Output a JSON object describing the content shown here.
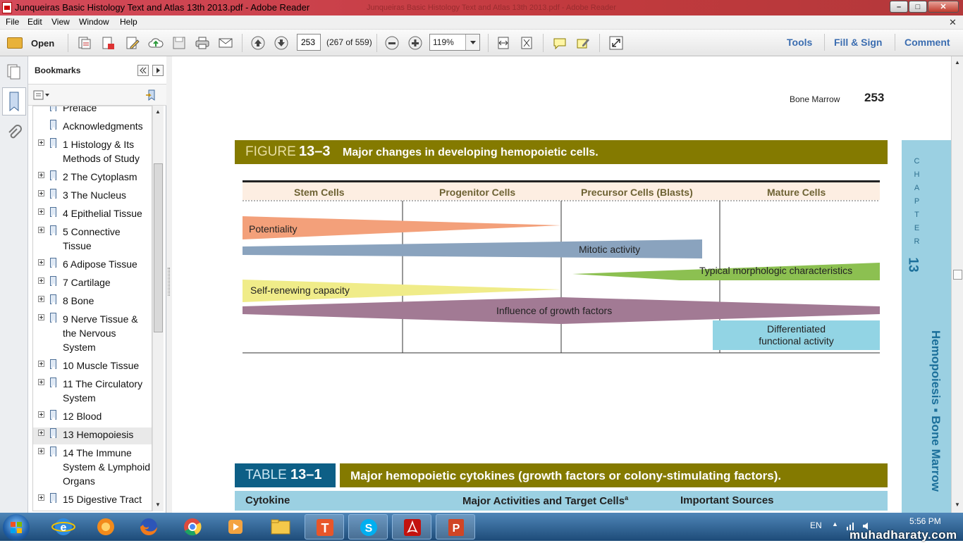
{
  "window": {
    "title": "Junqueiras Basic Histology Text and Atlas 13th 2013.pdf - Adobe Reader",
    "ghost_title": "Junqueiras Basic Histology Text and Atlas 13th 2013.pdf - Adobe Reader"
  },
  "menu": {
    "items": [
      "File",
      "Edit",
      "View",
      "Window",
      "Help"
    ]
  },
  "toolbar": {
    "open_label": "Open",
    "page_input": "253",
    "page_count": "(267 of 559)",
    "zoom": "119%",
    "tools_label": "Tools",
    "fill_sign_label": "Fill & Sign",
    "comment_label": "Comment"
  },
  "bookmarks": {
    "title": "Bookmarks",
    "items": [
      {
        "label": "Preface",
        "expandable": false
      },
      {
        "label": "Acknowledgments",
        "expandable": false
      },
      {
        "label": "1 Histology & Its Methods of Study",
        "expandable": true
      },
      {
        "label": "2 The Cytoplasm",
        "expandable": true
      },
      {
        "label": "3 The Nucleus",
        "expandable": true
      },
      {
        "label": "4 Epithelial Tissue",
        "expandable": true
      },
      {
        "label": "5 Connective Tissue",
        "expandable": true
      },
      {
        "label": "6 Adipose Tissue",
        "expandable": true
      },
      {
        "label": "7 Cartilage",
        "expandable": true
      },
      {
        "label": "8 Bone",
        "expandable": true
      },
      {
        "label": "9 Nerve Tissue & the Nervous System",
        "expandable": true
      },
      {
        "label": "10 Muscle Tissue",
        "expandable": true
      },
      {
        "label": "11 The Circulatory System",
        "expandable": true
      },
      {
        "label": "12 Blood",
        "expandable": true
      },
      {
        "label": "13 Hemopoiesis",
        "expandable": true,
        "selected": true
      },
      {
        "label": "14 The Immune System & Lymphoid Organs",
        "expandable": true
      },
      {
        "label": "15 Digestive Tract",
        "expandable": true
      }
    ]
  },
  "page": {
    "running_head": "Bone Marrow",
    "page_number": "253",
    "chapter_tab": {
      "letters": [
        "C",
        "H",
        "A",
        "P",
        "T",
        "E",
        "R"
      ],
      "number": "13",
      "title": "Hemopoiesis ▪ Bone Marrow"
    },
    "figure": {
      "label": "FIGURE",
      "number": "13–3",
      "caption": "Major changes in developing hemopoietic cells.",
      "columns": [
        "Stem Cells",
        "Progenitor Cells",
        "Precursor Cells (Blasts)",
        "Mature Cells"
      ],
      "bands": [
        {
          "label": "Potentiality",
          "color": "#f3a07a"
        },
        {
          "label": "Mitotic activity",
          "color": "#8aa3be"
        },
        {
          "label": "Typical morphologic characteristics",
          "color": "#8cc051"
        },
        {
          "label": "Self-renewing capacity",
          "color": "#f0ec89"
        },
        {
          "label": "Influence of growth factors",
          "color": "#a27a94"
        },
        {
          "label": "Differentiated functional activity",
          "line1": "Differentiated",
          "line2": "functional activity",
          "color": "#92d4e4"
        }
      ]
    },
    "table": {
      "label": "TABLE",
      "number": "13–1",
      "caption": "Major hemopoietic cytokines (growth factors or colony-stimulating factors).",
      "headers": [
        "Cytokine",
        "Major Activities and Target Cells",
        "Important Sources"
      ],
      "header_superscript": "a"
    }
  },
  "taskbar": {
    "language": "EN",
    "time": "5:56 PM",
    "watermark": "muhadharaty.com"
  },
  "colors": {
    "figure_bar": "#847a00",
    "table_bar": "#0d5f86",
    "chapter_tab": "#9bd0e2",
    "link_blue": "#3b6db0"
  }
}
